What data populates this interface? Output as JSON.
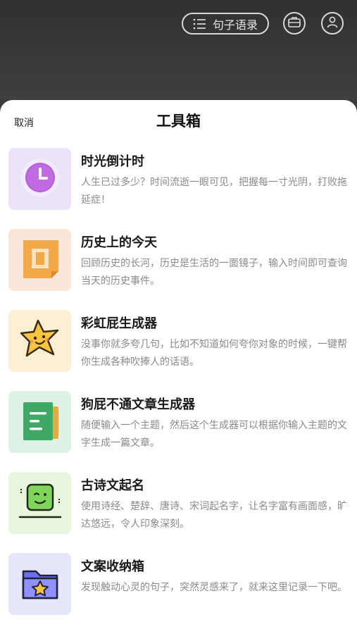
{
  "header": {
    "quotes_label": "句子语录",
    "icons": [
      "list-icon",
      "briefcase-icon",
      "user-icon"
    ]
  },
  "sheet": {
    "cancel_label": "取消",
    "title": "工具箱"
  },
  "tools": [
    {
      "name": "时光倒计时",
      "desc": "人生已过多少？时间流逝一眼可见，把握每一寸光阴，打败拖延症！",
      "icon": "clock-icon",
      "bg": "#ece3fb"
    },
    {
      "name": "历史上的今天",
      "desc": "回顾历史的长河，历史是生活的一面镜子，输入时间即可查询当天的历史事件。",
      "icon": "history-icon",
      "bg": "#fbe6da"
    },
    {
      "name": "彩虹屁生成器",
      "desc": "没事你就多夸几句，比如不知道如何夸你对象的时候，一键帮你生成各种吹捧人的话语。",
      "icon": "star-face-icon",
      "bg": "#fbf0d4"
    },
    {
      "name": "狗屁不通文章生成器",
      "desc": "随便输入一个主题，然后这个生成器可以根据你输入主题的文字生成一篇文章。",
      "icon": "document-icon",
      "bg": "#def3e6"
    },
    {
      "name": "古诗文起名",
      "desc": "使用诗经、楚辞、唐诗、宋词起名字，让名字富有画面感，旷达悠远，令人印象深刻。",
      "icon": "green-face-icon",
      "bg": "#e7f6dd"
    },
    {
      "name": "文案收纳箱",
      "desc": "发现触动心灵的句子，突然灵感来了，就来这里记录一下吧。",
      "icon": "folder-star-icon",
      "bg": "#e4e6fa"
    }
  ]
}
